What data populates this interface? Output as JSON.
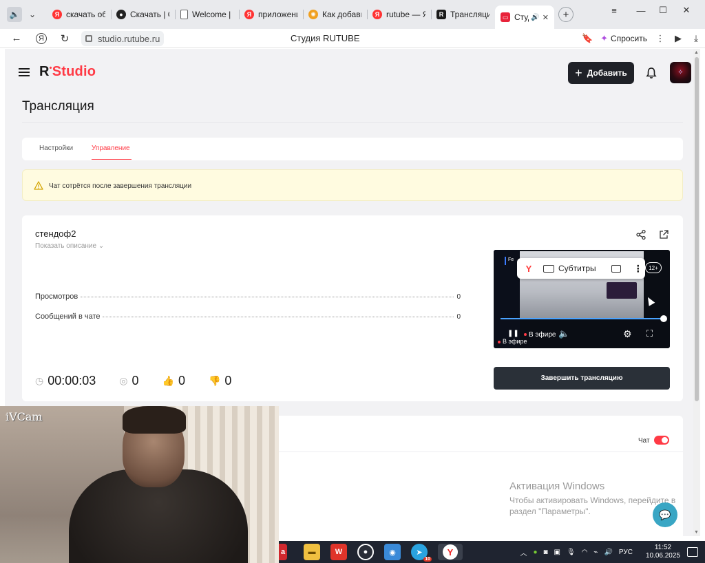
{
  "browser": {
    "tabs": [
      {
        "label": "скачать обс",
        "favicon": "yandex-icon",
        "color": "#ff3333"
      },
      {
        "label": "Скачать | O",
        "favicon": "obs-icon",
        "color": "#222222"
      },
      {
        "label": "Welcome | C",
        "favicon": "document-icon",
        "color": "#666666"
      },
      {
        "label": "приложени",
        "favicon": "yandex-icon",
        "color": "#ff3333"
      },
      {
        "label": "Как добави",
        "favicon": "sun-icon",
        "color": "#f0a020"
      },
      {
        "label": "rutube — Ян",
        "favicon": "yandex-icon",
        "color": "#ff3333"
      },
      {
        "label": "Трансляци",
        "favicon": "rutube-icon",
        "color": "#1a1a1a"
      }
    ],
    "active_tab": {
      "label": "Студи",
      "favicon": "rutube-icon",
      "color": "#e8233a"
    },
    "url": "studio.rutube.ru",
    "page_title": "Студия RUTUBE",
    "ask_label": "Спросить"
  },
  "studio": {
    "logo_r": "R",
    "logo_dot": "•",
    "logo_text": "Studio",
    "add_label": "Добавить",
    "accent": "#ff3a45"
  },
  "page": {
    "title": "Трансляция",
    "tabs": [
      {
        "label": "Настройки",
        "active": false
      },
      {
        "label": "Управление",
        "active": true
      }
    ],
    "warning": "Чат сотрётся после завершения трансляции"
  },
  "stream": {
    "name": "стендоф2",
    "show_description": "Показать описание",
    "stats": [
      {
        "label": "Просмотров",
        "value": "0"
      },
      {
        "label": "Сообщений в чате",
        "value": "0"
      }
    ],
    "duration": "00:00:03",
    "viewers": "0",
    "likes": "0",
    "dislikes": "0",
    "finish_label": "Завершить трансляцию"
  },
  "player": {
    "context_subtitles": "Субтитры",
    "age_rating": "12+",
    "live_label": "В эфире",
    "live_label_overlay": "В эфире",
    "logo_fragment": "Fe"
  },
  "chat": {
    "label": "Чат",
    "enabled": true
  },
  "windows_activation": {
    "title": "Активация Windows",
    "line1": "Чтобы активировать Windows, перейдите в",
    "line2": "раздел \"Параметры\"."
  },
  "webcam": {
    "brand": "iVCam"
  },
  "taskbar": {
    "lang": "РУС",
    "time": "11:52",
    "date": "10.06.2025",
    "badge": "10"
  }
}
